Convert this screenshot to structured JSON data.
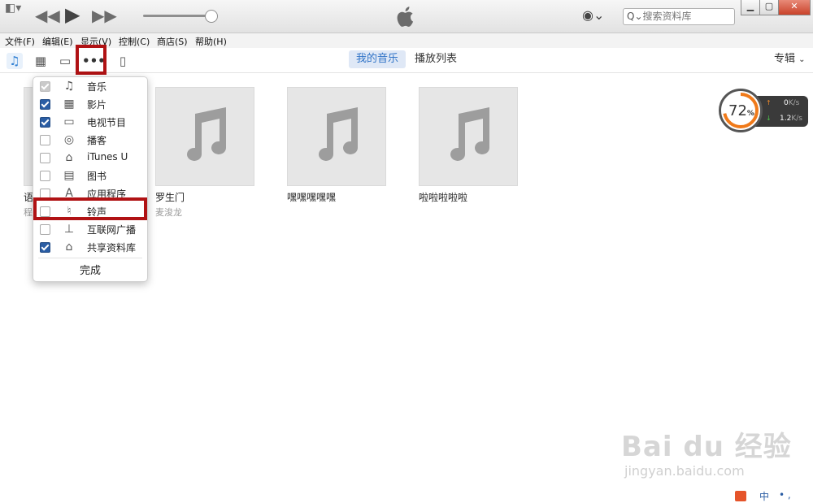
{
  "search": {
    "placeholder": "搜索资料库"
  },
  "menu": [
    "文件(F)",
    "编辑(E)",
    "显示(V)",
    "控制(C)",
    "商店(S)",
    "帮助(H)"
  ],
  "toolbar": {
    "tab_my_music": "我的音乐",
    "tab_playlists": "播放列表",
    "view": "专辑"
  },
  "albums": [
    {
      "title": "语",
      "artist": "程"
    },
    {
      "title": "罗生门",
      "artist": "麦浚龙"
    },
    {
      "title": "嘿嘿嘿嘿嘿",
      "artist": ""
    },
    {
      "title": "啦啦啦啦啦",
      "artist": ""
    }
  ],
  "dropdown": {
    "items": [
      {
        "label": "音乐",
        "icon": "music-note-icon",
        "state": "disabled"
      },
      {
        "label": "影片",
        "icon": "film-icon",
        "state": "checked"
      },
      {
        "label": "电视节目",
        "icon": "tv-icon",
        "state": "checked"
      },
      {
        "label": "播客",
        "icon": "podcast-icon",
        "state": "unchecked"
      },
      {
        "label": "iTunes U",
        "icon": "graduation-cap-icon",
        "state": "unchecked"
      },
      {
        "label": "图书",
        "icon": "book-icon",
        "state": "unchecked"
      },
      {
        "label": "应用程序",
        "icon": "app-store-icon",
        "state": "unchecked"
      },
      {
        "label": "铃声",
        "icon": "bell-icon",
        "state": "unchecked"
      },
      {
        "label": "互联网广播",
        "icon": "antenna-icon",
        "state": "unchecked"
      },
      {
        "label": "共享资料库",
        "icon": "home-share-icon",
        "state": "checked"
      }
    ],
    "done_label": "完成"
  },
  "speed_widget": {
    "percent": "72",
    "percent_sign": "%",
    "up": "0",
    "up_unit": "K/s",
    "down": "1.2",
    "down_unit": "K/s",
    "ring_color": "#f07a1a"
  },
  "watermark": {
    "logo": "Bai du 经验",
    "sub": "jingyan.baidu.com"
  },
  "colors": {
    "highlight": "#b01214",
    "accent": "#2f73c7"
  }
}
